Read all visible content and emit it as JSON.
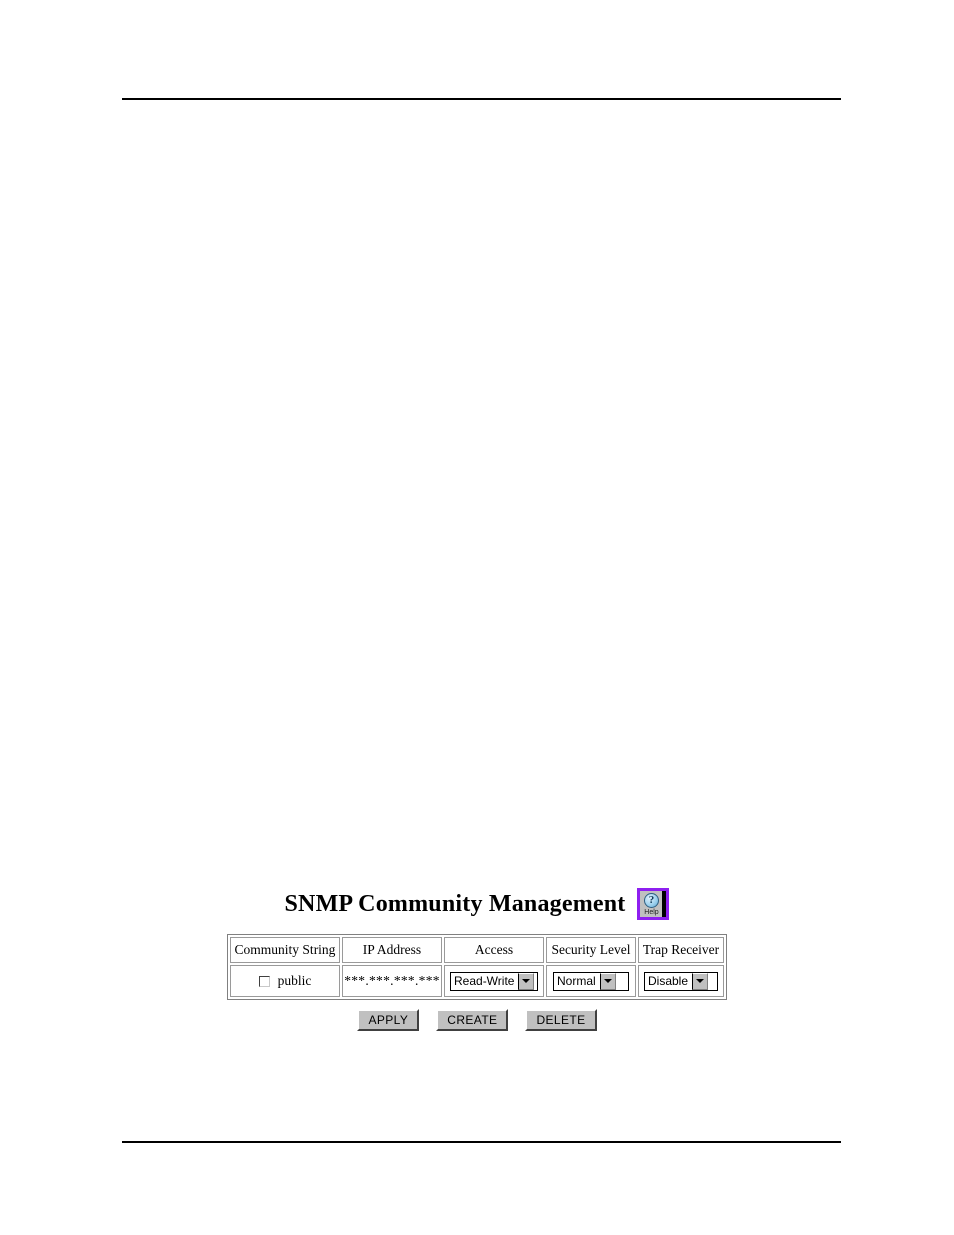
{
  "page": {
    "has_top_rule": true,
    "has_bottom_rule": true
  },
  "figure": {
    "title": "SNMP Community Management",
    "help_button": {
      "icon": "question-mark-help-icon",
      "glyph": "?",
      "label": "Help",
      "border_color": "#8e1ff0",
      "face_color": "#c0c0c0"
    },
    "table": {
      "headers": [
        "Community String",
        "IP Address",
        "Access",
        "Security Level",
        "Trap Receiver"
      ],
      "rows": [
        {
          "community_string": {
            "checked": false,
            "label": "public"
          },
          "ip_address": "***.***.***.***",
          "access": "Read-Write",
          "security_level": "Normal",
          "trap_receiver": "Disable"
        }
      ]
    },
    "buttons": [
      {
        "label": "APPLY"
      },
      {
        "label": "CREATE"
      },
      {
        "label": "DELETE"
      }
    ]
  }
}
